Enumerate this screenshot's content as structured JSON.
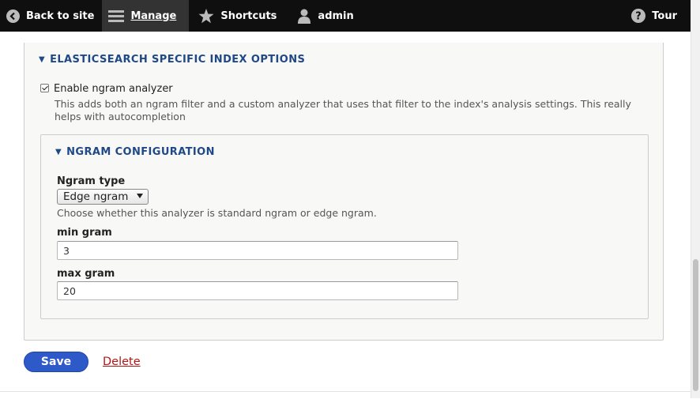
{
  "toolbar": {
    "back_label": "Back to site",
    "manage_label": "Manage",
    "shortcuts_label": "Shortcuts",
    "user_label": "admin",
    "tour_label": "Tour"
  },
  "outer_section": {
    "title": "ELASTICSEARCH SPECIFIC INDEX OPTIONS",
    "checkbox_label": "Enable ngram analyzer",
    "checkbox_checked": true,
    "description": "This adds both an ngram filter and a custom analyzer that uses that filter to the index's analysis settings. This really helps with autocompletion"
  },
  "ngram_section": {
    "title": "NGRAM CONFIGURATION",
    "type_label": "Ngram type",
    "type_value": "Edge ngram",
    "type_description": "Choose whether this analyzer is standard ngram or edge ngram.",
    "min_label": "min gram",
    "min_value": "3",
    "max_label": "max gram",
    "max_value": "20"
  },
  "actions": {
    "save_label": "Save",
    "delete_label": "Delete"
  },
  "colors": {
    "toolbar_bg": "#0f0f0f",
    "accent_blue": "#2e5ac9",
    "heading_blue": "#1f4887",
    "delete_red": "#b01818"
  }
}
